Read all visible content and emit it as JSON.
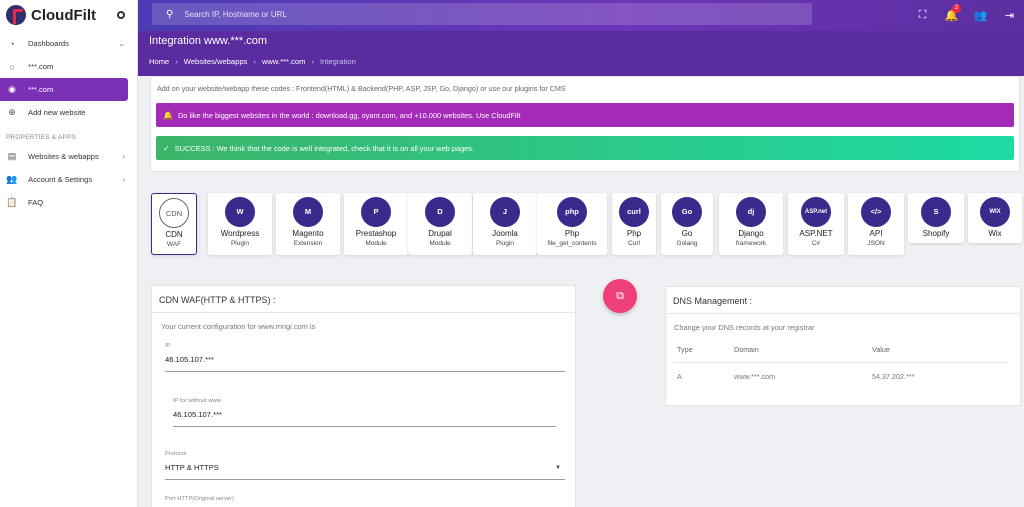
{
  "app": {
    "name": "CloudFilt"
  },
  "sidebar": {
    "items": [
      {
        "label": "Dashboards",
        "icon": "gauge-icon"
      },
      {
        "label": "***.com",
        "icon": "radio-icon"
      },
      {
        "label": "***.com",
        "icon": "radio-checked-icon"
      },
      {
        "label": "Add new website",
        "icon": "plus-circle-icon"
      }
    ],
    "section_label": "PROPERTIES & APPS",
    "apps": [
      {
        "label": "Websites & webapps",
        "icon": "web-icon"
      },
      {
        "label": "Account & Settings",
        "icon": "users-icon"
      },
      {
        "label": "FAQ",
        "icon": "clipboard-icon"
      }
    ]
  },
  "topbar": {
    "search_placeholder": "Search IP, Hostname or URL",
    "notification_count": "2"
  },
  "header": {
    "title": "Integration www.***.com",
    "breadcrumb": [
      "Home",
      "Websites/webapps",
      "www.***.com",
      "Integration"
    ]
  },
  "info": {
    "text": "Add on your website/webapp these codes : Frontend(HTML) & Backend(PHP, ASP, JSP, Go, Django) or use our plugins for CMS",
    "alert_purple": "Do like the biggest websites in the world : download.gg, oyant.com, and +10.000 websites. Use CloudFilt",
    "alert_green": "SUCCESS : We think that the code is well integrated, check that it is on all your web pages."
  },
  "tiles": [
    {
      "icon_text": "CDN",
      "line1": "CDN",
      "line2": "WAF"
    },
    {
      "icon_text": "W",
      "line1": "Wordpress",
      "line2": "Plugin"
    },
    {
      "icon_text": "M",
      "line1": "Magento",
      "line2": "Extension"
    },
    {
      "icon_text": "P",
      "line1": "Prestashop",
      "line2": "Module"
    },
    {
      "icon_text": "D",
      "line1": "Drupal",
      "line2": "Module"
    },
    {
      "icon_text": "J",
      "line1": "Joomla",
      "line2": "Plugin"
    },
    {
      "icon_text": "php",
      "line1": "Php",
      "line2": "file_get_contents"
    },
    {
      "icon_text": "curl",
      "line1": "Php",
      "line2": "Curl"
    },
    {
      "icon_text": "Go",
      "line1": "Go",
      "line2": "Golang"
    },
    {
      "icon_text": "dj",
      "line1": "Django",
      "line2": "framework"
    },
    {
      "icon_text": "ASP.net",
      "line1": "ASP.NET",
      "line2": "C#"
    },
    {
      "icon_text": "</>",
      "line1": "API",
      "line2": "JSON"
    },
    {
      "icon_text": "S",
      "line1": "Shopify",
      "line2": ""
    },
    {
      "icon_text": "WIX",
      "line1": "Wix",
      "line2": ""
    }
  ],
  "cdn": {
    "title": "CDN WAF(HTTP & HTTPS) :",
    "subtitle": "Your current configuration for www.mrigi.com is",
    "ip_label": "IP",
    "ip_value": "46.105.107.***",
    "ip_www_label": "IP for without www",
    "ip_www_value": "46.105.107.***",
    "protocol_label": "Protocol",
    "protocol_value": "HTTP & HTTPS",
    "port_label": "Port HTTP(Original server)"
  },
  "dns": {
    "title": "DNS Management :",
    "subtitle": "Change your DNS records at your registrar",
    "columns": [
      "Type",
      "Domain",
      "Value"
    ],
    "rows": [
      {
        "type": "A",
        "domain": "www.***.com",
        "value": "54.37.202.***"
      }
    ]
  }
}
